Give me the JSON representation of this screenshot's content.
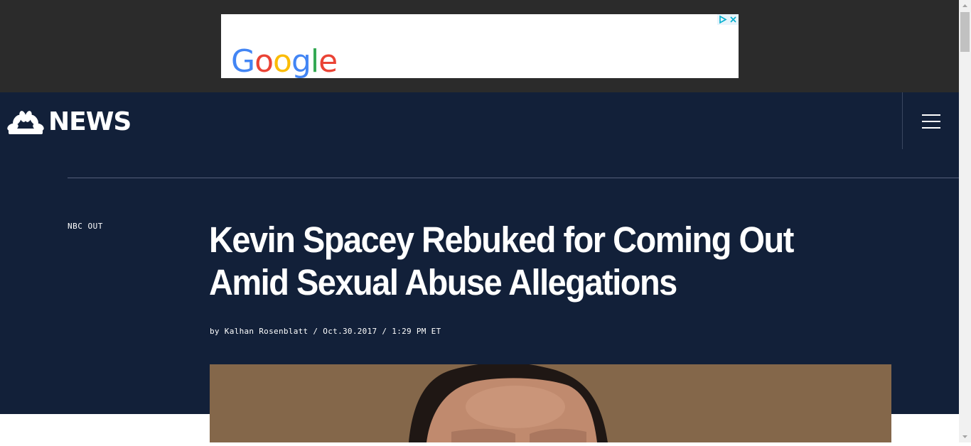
{
  "ad": {
    "brand_letters": [
      "G",
      "o",
      "o",
      "g",
      "l",
      "e"
    ],
    "adchoices_icon": "adchoices-triangle-icon",
    "close_icon": "close-x-icon"
  },
  "header": {
    "logo_text": "NEWS",
    "logo_icon": "nbc-peacock-icon",
    "menu_icon": "hamburger-menu-icon"
  },
  "article": {
    "section": "NBC OUT",
    "headline": "Kevin Spacey Rebuked for Coming Out Amid Sexual Abuse Allegations",
    "byline_prefix": "by",
    "author": "Kalhan Rosenblatt",
    "separator": "/",
    "date": "Oct.30.2017",
    "time": "1:29 PM ET"
  },
  "colors": {
    "header_bg": "#122039",
    "ad_bar_bg": "#2b2b2b",
    "text": "#ffffff"
  }
}
